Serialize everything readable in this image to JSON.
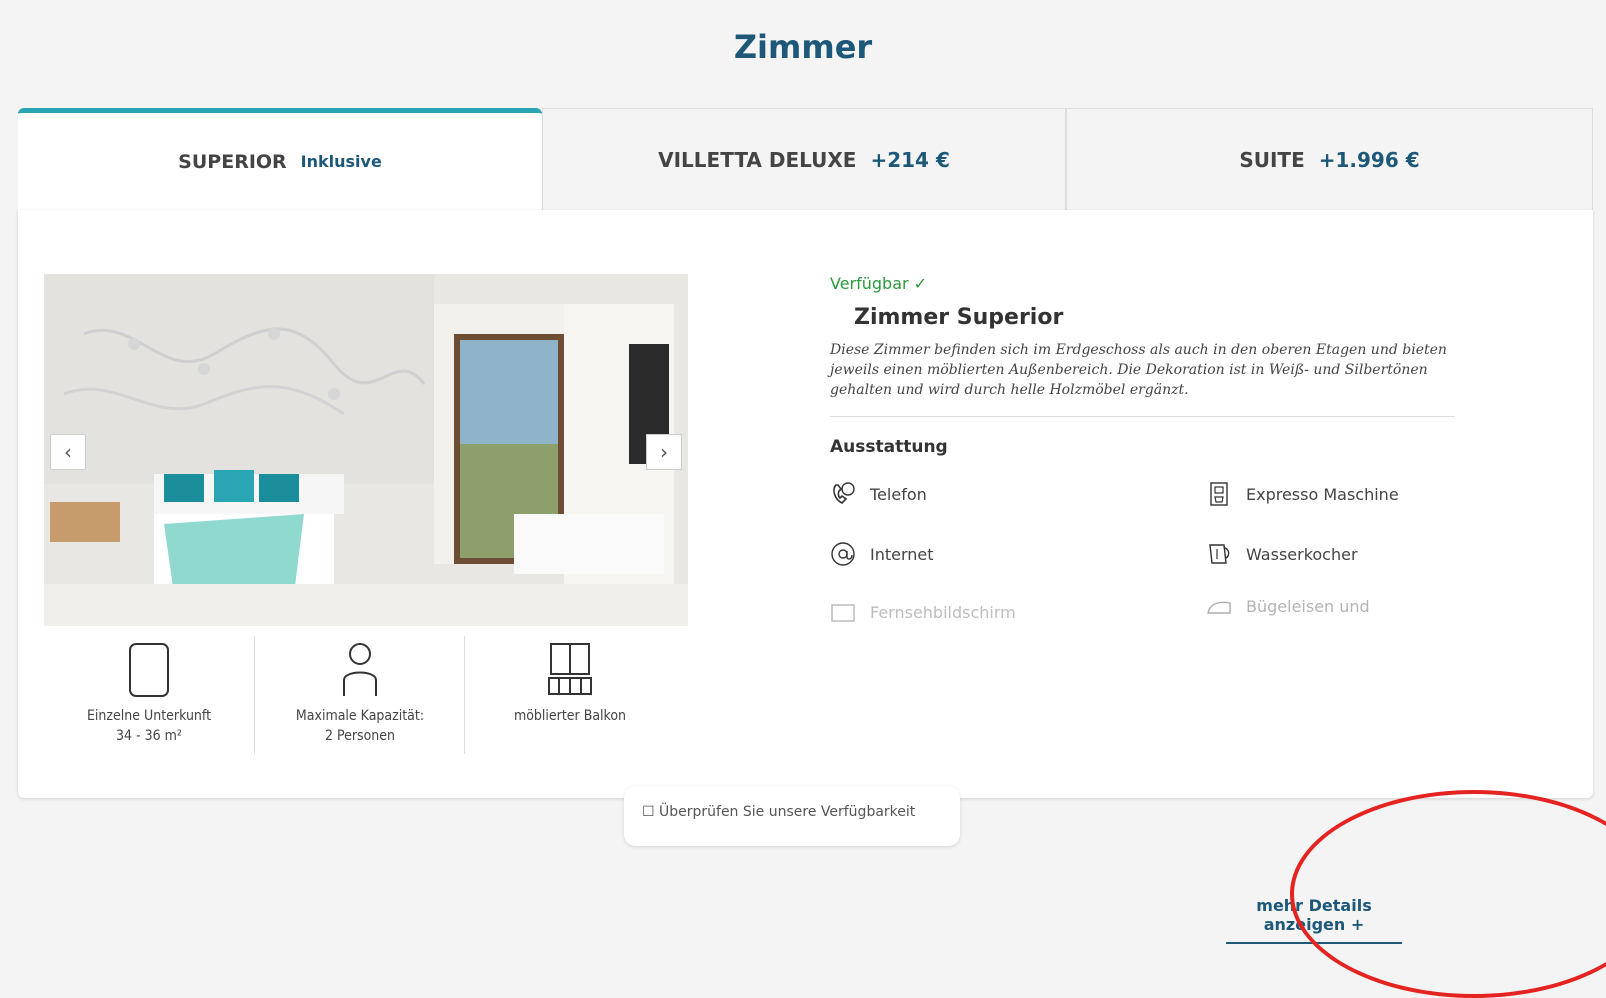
{
  "page": {
    "title": "Zimmer"
  },
  "tabs": [
    {
      "label": "SUPERIOR",
      "price": "Inklusive",
      "active": true
    },
    {
      "label": "VILLETTA DELUXE",
      "price": "+214 €",
      "active": false
    },
    {
      "label": "SUITE",
      "price": "+1.996 €",
      "active": false
    }
  ],
  "gallery": {
    "prev_label": "‹",
    "next_label": "›"
  },
  "features": [
    {
      "icon": "room-size-icon",
      "line1": "Einzelne Unterkunft",
      "line2": "34 - 36 m²"
    },
    {
      "icon": "person-icon",
      "line1": "Maximale Kapazität:",
      "line2": "2 Personen"
    },
    {
      "icon": "balcony-icon",
      "line1": "möblierter Balkon",
      "line2": ""
    }
  ],
  "room": {
    "availability": "Verfügbar ✓",
    "name": "Zimmer Superior",
    "description": "Diese Zimmer befinden sich im Erdgeschoss als auch in den oberen Etagen und bieten jeweils einen möblierten Außenbereich. Die Dekoration ist in Weiß- und Silbertönen gehalten und wird durch helle Holzmöbel ergänzt."
  },
  "amenities": {
    "title": "Ausstattung",
    "items": [
      {
        "icon": "phone-icon",
        "label": "Telefon"
      },
      {
        "icon": "at-icon",
        "label": "Internet"
      },
      {
        "icon": "tv-icon",
        "label": "Fernsehbildschirm"
      },
      {
        "icon": "coffee-machine-icon",
        "label": "Expresso Maschine"
      },
      {
        "icon": "kettle-icon",
        "label": "Wasserkocher"
      },
      {
        "icon": "iron-icon",
        "label": "Bügeleisen und"
      }
    ],
    "more_label": "mehr Details anzeigen +"
  },
  "bottom": {
    "pill_text": "☐ Überprüfen Sie unsere Verfügbarkeit"
  },
  "colors": {
    "accent": "#2aa5b3",
    "brand": "#1d5878",
    "available": "#2a9a3c",
    "annotation": "#e52320"
  }
}
